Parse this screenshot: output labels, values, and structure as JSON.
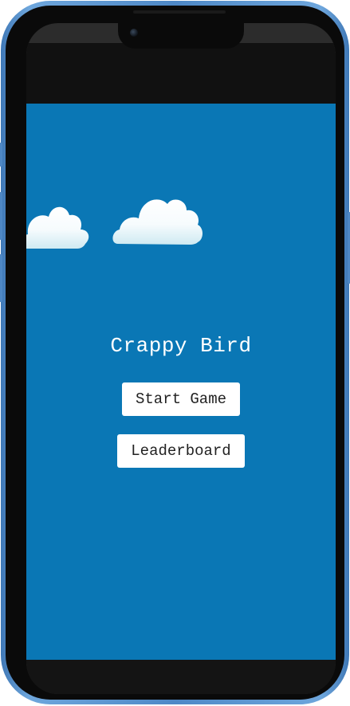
{
  "game": {
    "title": "Crappy Bird",
    "background_color": "#0a77b5",
    "menu": {
      "start_label": "Start Game",
      "leaderboard_label": "Leaderboard"
    },
    "clouds": [
      "cloud-icon",
      "cloud-icon"
    ]
  },
  "device": {
    "frame_color": "#4e88c6",
    "bezel_color": "#0a0a0a"
  }
}
